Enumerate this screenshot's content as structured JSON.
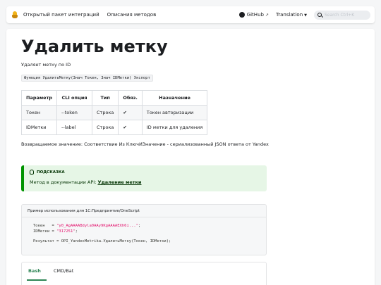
{
  "navbar": {
    "brand": "Открытый пакет интеграций",
    "methods_link": "Описания методов",
    "github": "GitHub",
    "translation": "Translation",
    "search_placeholder": "Search Ctrl+K"
  },
  "page": {
    "title": "Удалить метку",
    "description": "Удаляет метку по ID",
    "signature": "Функция УдалитьМетку(Знач Токен, Знач IDМетки) Экспорт",
    "returns": "Возвращаемое значение: Соответствие Из КлючИЗначение - сериализованный JSON ответа от Yandex"
  },
  "params_table": {
    "headers": [
      "Параметр",
      "CLI опция",
      "Тип",
      "Обяз.",
      "Назначение"
    ],
    "rows": [
      [
        "Токен",
        "--token",
        "Строка",
        "✔",
        "Токен авторизации"
      ],
      [
        "IDМетки",
        "--label",
        "Строка",
        "✔",
        "ID метки для удаления"
      ]
    ]
  },
  "tip": {
    "title": "ПОДСКАЗКА",
    "text": "Метод в документации API: ",
    "link": "Удаление метки"
  },
  "code": {
    "title": "Пример использования для 1С:Предприятие/OneScript",
    "line1_prefix": "Токен   = ",
    "line1_value": "\"y0_AgAAAABdyla0AAy9KgAAAAEXh6i...\"",
    "line1_suffix": ";",
    "line2_prefix": "IDМетки = ",
    "line2_value": "\"317251\"",
    "line2_suffix": ";",
    "line3": "Результат = OPI_YandexMetrika.УдалитьМетку(Токен, IDМетки);"
  },
  "tabs": [
    "Bash",
    "CMD/Bat"
  ],
  "colors": {
    "accent": "#2e8555",
    "tip_bg": "#e6f6e6",
    "tip_border": "#009400",
    "string": "#e3116c"
  }
}
